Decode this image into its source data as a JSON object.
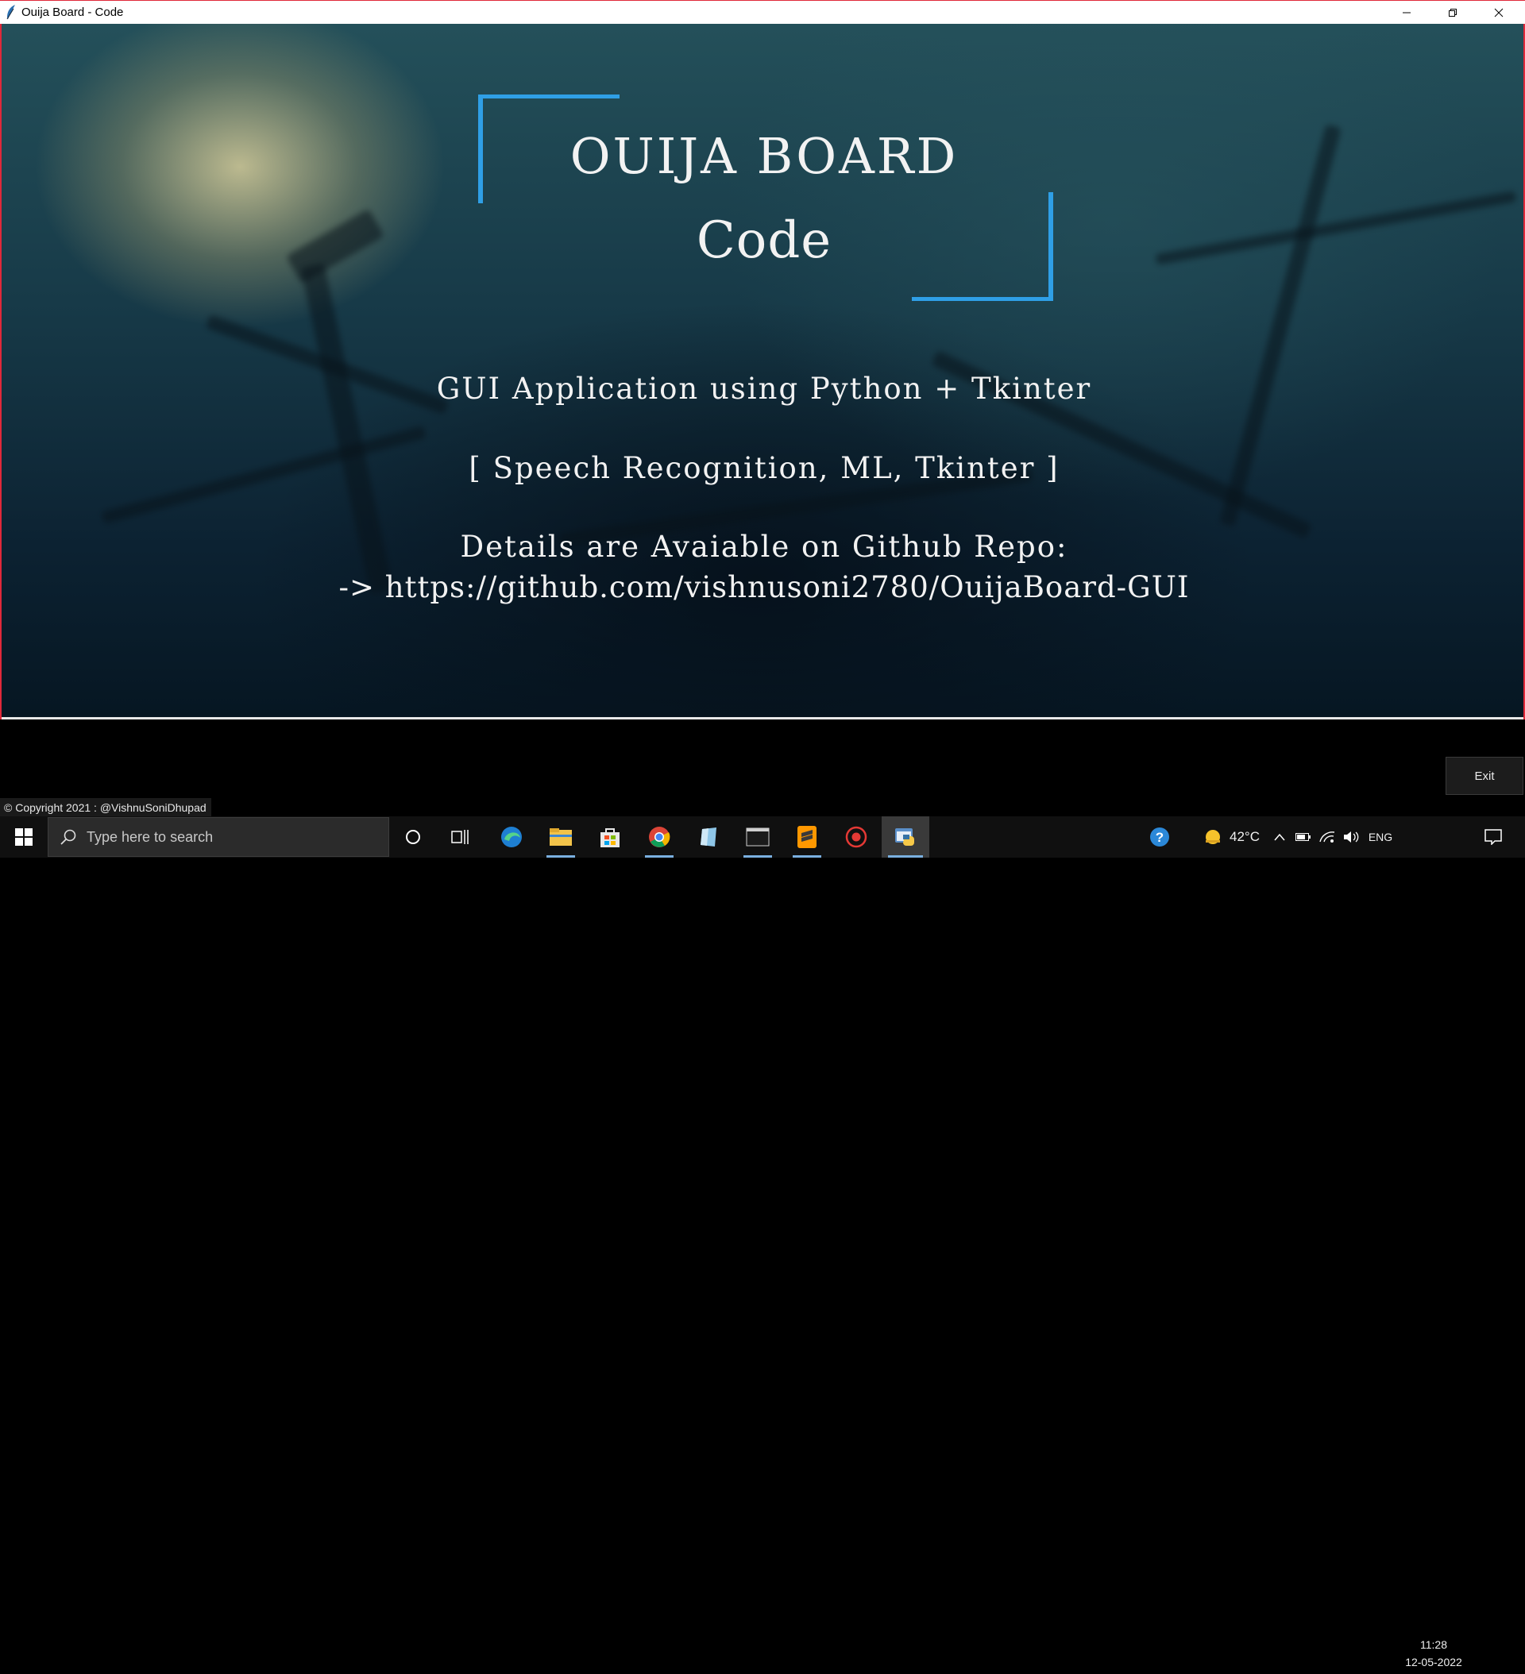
{
  "window": {
    "title": "Ouija Board - Code",
    "icon": "feather-icon"
  },
  "canvas": {
    "heading": "OUIJA BOARD",
    "subheading": "Code",
    "description": "GUI Application using Python + Tkinter",
    "tags": "[ Speech Recognition, ML, Tkinter ]",
    "details_label": "Details are Avaiable on Github Repo:",
    "repo_link": "-> https://github.com/vishnusoni2780/OuijaBoard-GUI",
    "accent_color": "#2f9fe6"
  },
  "footer": {
    "copyright": "© Copyright 2021 : @VishnuSoniDhupad",
    "exit_label": "Exit"
  },
  "taskbar": {
    "search_placeholder": "Type here to search",
    "apps": [
      "cortana-icon",
      "task-view-icon",
      "edge-icon",
      "file-explorer-icon",
      "store-icon",
      "chrome-icon",
      "notes-icon",
      "terminal-icon",
      "sublime-icon",
      "recorder-icon",
      "python-icon"
    ],
    "weather_temp": "42°C",
    "language": "ENG",
    "time": "11:28",
    "date": "12-05-2022"
  }
}
